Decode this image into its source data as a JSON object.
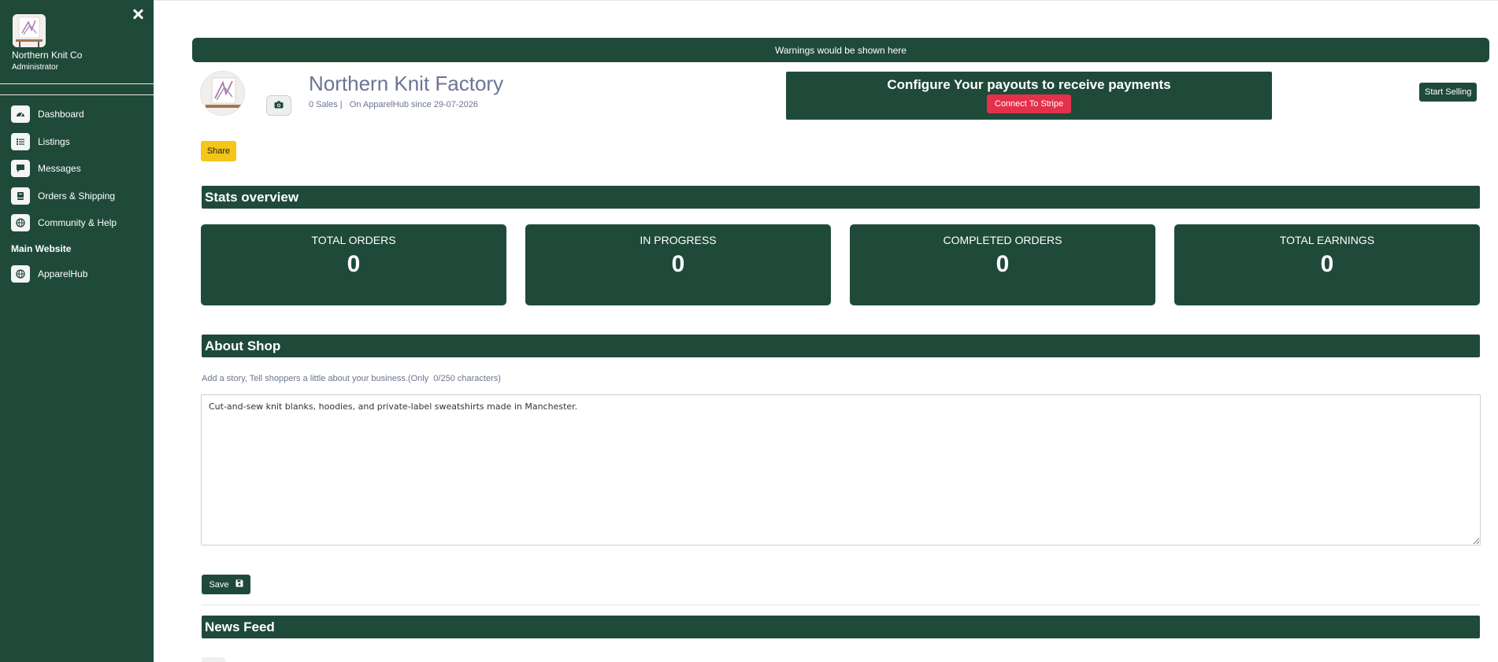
{
  "sidebar": {
    "shop_name": "Northern Knit Co",
    "role": "Administrator",
    "items": [
      {
        "label": "Dashboard",
        "icon": "dashboard-icon"
      },
      {
        "label": "Listings",
        "icon": "list-icon"
      },
      {
        "label": "Messages",
        "icon": "message-icon"
      },
      {
        "label": "Orders & Shipping",
        "icon": "book-icon"
      },
      {
        "label": "Community & Help",
        "icon": "globe-icon"
      }
    ],
    "section_title": "Main Website",
    "website_item": {
      "label": "ApparelHub",
      "icon": "globe-icon"
    }
  },
  "warning_text": "Warnings would be shown here",
  "shop": {
    "title": "Northern Knit Factory",
    "meta": "0 Sales |   On ApparelHub since 29-07-2026"
  },
  "stripe": {
    "heading": "Configure Your payouts to receive payments",
    "button": "Connect To Stripe"
  },
  "start_selling": "Start Selling",
  "share": "Share",
  "stats": {
    "title": "Stats overview",
    "cards": [
      {
        "label": "TOTAL ORDERS",
        "value": "0"
      },
      {
        "label": "IN PROGRESS",
        "value": "0"
      },
      {
        "label": "COMPLETED ORDERS",
        "value": "0"
      },
      {
        "label": "TOTAL EARNINGS",
        "value": "0"
      }
    ]
  },
  "about": {
    "title": "About Shop",
    "hint": "Add a story, Tell shoppers a little about your business.(Only  0/250 characters)",
    "text": "Cut-and-sew knit blanks, hoodies, and private-label sweatshirts made in Manchester.",
    "save": "Save"
  },
  "news_feed": {
    "title": "News Feed"
  },
  "colors": {
    "brand": "#1f4a3a",
    "accent_yellow": "#f5c518",
    "stripe_red": "#e4304a"
  }
}
